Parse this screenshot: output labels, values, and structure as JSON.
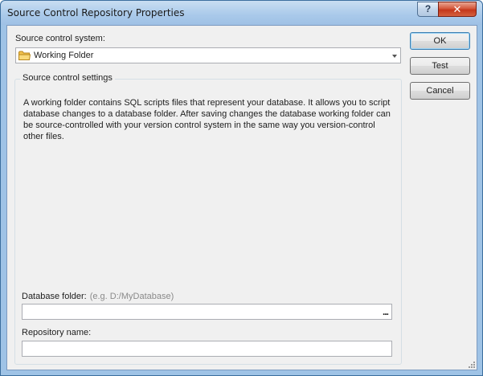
{
  "window": {
    "title": "Source Control Repository Properties",
    "help_glyph": "?",
    "close_glyph": "✕"
  },
  "source_control_system": {
    "label": "Source control system:",
    "selected": "Working Folder",
    "icon": "folder-icon"
  },
  "settings_group": {
    "title": "Source control settings",
    "description": "A working folder contains SQL scripts files that represent your database. It allows you to script database changes to a database folder. After saving changes the database working folder can be source-controlled with your version control system in the same way you version-control other files."
  },
  "database_folder": {
    "label": "Database folder:",
    "hint": "(e.g. D:/MyDatabase)",
    "value": "",
    "browse_label": "..."
  },
  "repository_name": {
    "label": "Repository name:",
    "value": ""
  },
  "buttons": {
    "ok": "OK",
    "test": "Test",
    "cancel": "Cancel"
  },
  "colors": {
    "title_bar": "#a9c9ea",
    "close_button": "#c4371b",
    "client_bg": "#f0f0f0",
    "folder_icon": "#f2c14e"
  }
}
